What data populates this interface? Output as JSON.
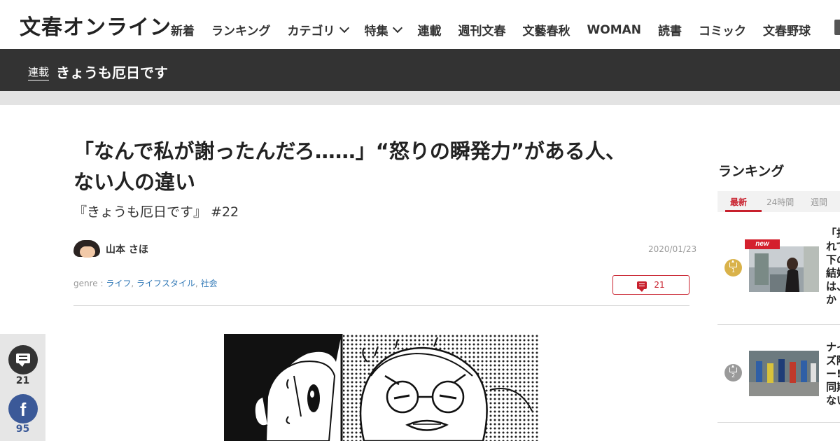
{
  "header": {
    "logo": "文春オンライン",
    "nav": [
      {
        "label": "新着"
      },
      {
        "label": "ランキング"
      },
      {
        "label": "カテゴリ",
        "dropdown": true
      },
      {
        "label": "特集",
        "dropdown": true
      },
      {
        "label": "連載"
      },
      {
        "label": "週刊文春"
      },
      {
        "label": "文藝春秋"
      },
      {
        "label": "WOMAN"
      },
      {
        "label": "読書"
      },
      {
        "label": "コミック"
      },
      {
        "label": "文春野球"
      }
    ]
  },
  "series_bar": {
    "tag": "連載",
    "name": "きょうも厄日です"
  },
  "article": {
    "title_line1": "「なんで私が謝ったんだろ……」“怒りの瞬発力”がある人、",
    "title_line2": "ない人の違い",
    "subtitle": "『きょうも厄日です』 #22",
    "author": "山本 さほ",
    "date": "2020/01/23",
    "genre_prefix": "genre : ",
    "genres": [
      "ライフ",
      "ライフスタイル",
      "社会"
    ],
    "genre_sep": ", ",
    "comment_count": "21"
  },
  "share": {
    "comment_count": "21",
    "facebook_icon_glyph": "f",
    "facebook_count": "95"
  },
  "ranking": {
    "title": "ランキング",
    "tabs": [
      "最新",
      "24時間",
      "週間"
    ],
    "active_tab": "最新",
    "new_label": "new",
    "items": [
      {
        "rank": "1",
        "text": "「択\nれて\n下の\n結婚\nは、\nか"
      },
      {
        "rank": "2",
        "text": "ナイ\nズ降\nー!\n同期\nない"
      }
    ]
  },
  "colors": {
    "accent_red": "#c8202d",
    "series_bar_bg": "#333333",
    "link_blue": "#2d76b5",
    "facebook_blue": "#3b5998",
    "gold_badge": "#d9b24a",
    "silver_badge": "#9a9a9a"
  }
}
